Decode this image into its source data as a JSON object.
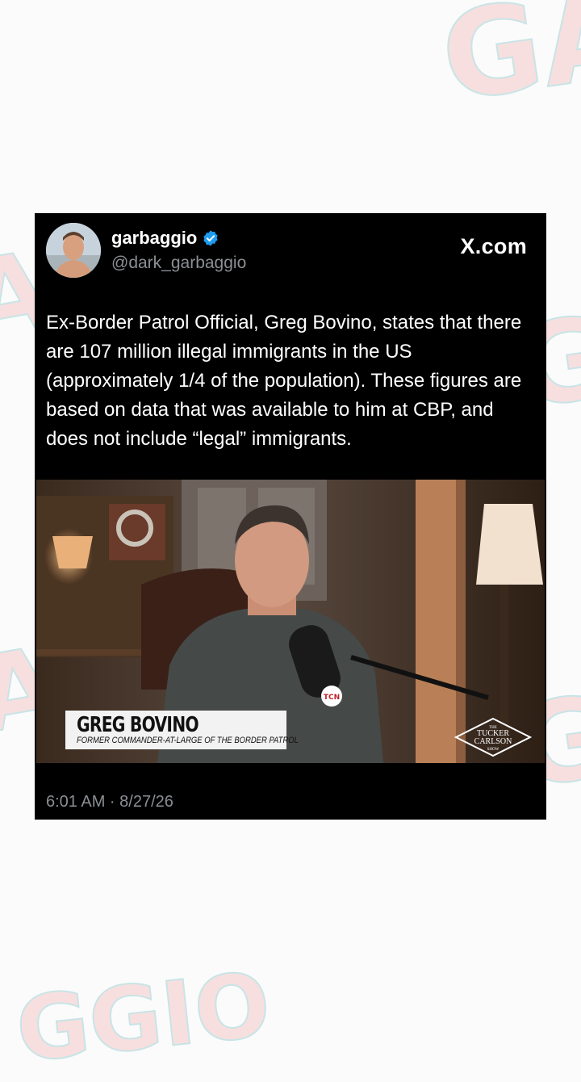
{
  "watermark": {
    "text_a": "GA",
    "text_b": "GGIO"
  },
  "post": {
    "display_name": "garbaggio",
    "handle": "@dark_garbaggio",
    "source": "X.com",
    "text": "Ex-Border Patrol Official, Greg Bovino, states that there are 107 million illegal immigrants in the US (approximately 1/4 of the population). These figures are based on data that was available to him at CBP, and does not include “legal” immigrants.",
    "timestamp": "6:01 AM · 8/27/26"
  },
  "video": {
    "lower_third_name": "GREG BOVINO",
    "lower_third_title": "FORMER COMMANDER-AT-LARGE OF THE BORDER PATROL",
    "mic_flag": "TCN",
    "show_logo": {
      "line1": "THE",
      "line2": "TUCKER",
      "line3": "CARLSON",
      "line4": "SHOW"
    }
  },
  "icons": {
    "verified": "verified-badge-icon",
    "avatar": "avatar"
  },
  "colors": {
    "card_bg": "#000000",
    "secondary_text": "#8b8f94",
    "verified_blue": "#1d9bf0"
  }
}
